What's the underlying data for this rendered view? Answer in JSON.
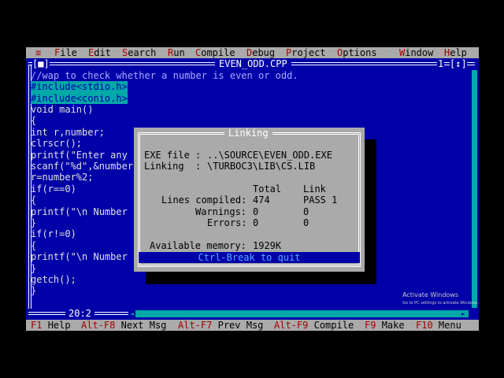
{
  "menu": {
    "system": "≡",
    "items": [
      {
        "hot": "F",
        "rest": "ile"
      },
      {
        "hot": "E",
        "rest": "dit"
      },
      {
        "hot": "S",
        "rest": "earch"
      },
      {
        "hot": "R",
        "rest": "un"
      },
      {
        "hot": "C",
        "rest": "ompile"
      },
      {
        "hot": "D",
        "rest": "ebug"
      },
      {
        "hot": "P",
        "rest": "roject"
      },
      {
        "hot": "O",
        "rest": "ptions"
      },
      {
        "hot": "W",
        "rest": "indow"
      },
      {
        "hot": "H",
        "rest": "elp"
      }
    ]
  },
  "editor": {
    "close_box": "[■]",
    "filename": "EVEN_ODD.CPP",
    "window_number": "1",
    "zoom_box": "[↕]",
    "cursor_position": "20:2",
    "lines": [
      "//wap to check whether a number is even or odd.",
      "#include<stdio.h>",
      "#include<conio.h>",
      "void main()",
      "{",
      "int r,number;",
      "clrscr();",
      "printf(\"Enter any",
      "scanf(\"%d\",&number",
      "r=number%2;",
      "if(r==0)",
      "{",
      "printf(\"\\n Number",
      "}",
      "if(r!=0)",
      "{",
      "printf(\"\\n Number",
      "}",
      "getch();",
      "}"
    ]
  },
  "dialog": {
    "title": "Linking",
    "exe_label": "EXE file : ",
    "exe_value": "..\\SOURCE\\EVEN_ODD.EXE",
    "linking_label": "Linking  : ",
    "linking_value": "\\TURBOC3\\LIB\\CS.LIB",
    "col_total": "Total",
    "col_link": "Link",
    "lines_label": "Lines compiled:",
    "lines_total": "474",
    "lines_link": "PASS 1",
    "warnings_label": "Warnings:",
    "warnings_total": "0",
    "warnings_link": "0",
    "errors_label": "Errors:",
    "errors_total": "0",
    "errors_link": "0",
    "memory_label": "Available memory:",
    "memory_value": "1929K",
    "quit_label": "Ctrl-Break to quit"
  },
  "statusbar": [
    {
      "key": "F1",
      "label": "Help"
    },
    {
      "key": "Alt-F8",
      "label": "Next Msg"
    },
    {
      "key": "Alt-F7",
      "label": "Prev Msg"
    },
    {
      "key": "Alt-F9",
      "label": "Compile"
    },
    {
      "key": "F9",
      "label": "Make"
    },
    {
      "key": "F10",
      "label": "Menu"
    }
  ],
  "watermark": {
    "title": "Activate Windows",
    "subtitle": "Go to PC settings to activate Windows."
  }
}
